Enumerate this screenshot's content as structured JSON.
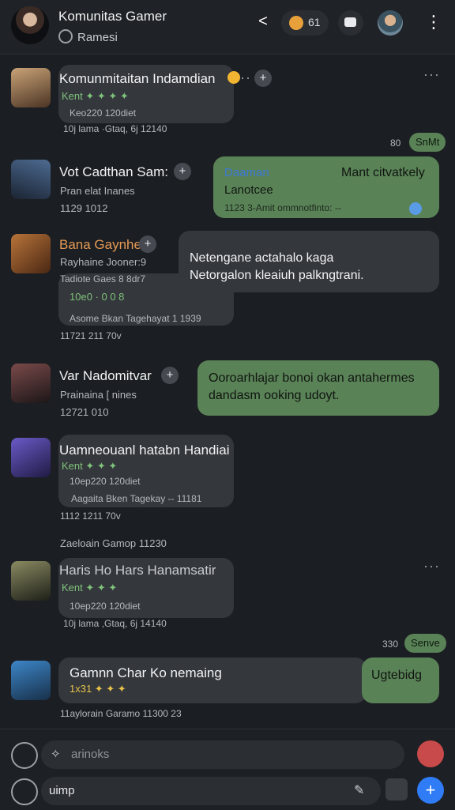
{
  "header": {
    "title": "Komunitas Gamer",
    "subtitle": "Ramesi",
    "pill_label": "61",
    "share_label": "<",
    "more_label": "⋮"
  },
  "messages": [
    {
      "name": "Komunmitaitan Indamdian",
      "green": "Kent ✦ ✦ ✦ ✦",
      "sub": "Keo220 120diet",
      "time": "10j lama ·Gtaq, 6j 12140"
    },
    {
      "name": "Vot Cadthan Sam:",
      "role": "Pran elat  Inanes",
      "time": "1129 1012"
    },
    {
      "name": "Bana Gaynhe",
      "role": "Rayhaine Jooner:9",
      "sub": "Tadiote Gaes 8 8dr7",
      "green": "10e0 · 0 0 8",
      "meta": "Asome Bkan Tagehayat 1 1939",
      "time": "11721 211 70v"
    },
    {
      "name": "Var Nadomitvar",
      "role": "Prainaina  [ nines",
      "time": "12721 010"
    },
    {
      "name": "Uamneouanl hatabn Handiai",
      "green": "Kent ✦ ✦ ✦",
      "sub": "10ep220 120diet",
      "meta": "Aagaita Bken Tagekay -- 11181",
      "time": "1112 1211 70v"
    },
    {
      "name": "Haris Ho Hars Hanamsatir",
      "green": "Kent ✦ ✦ ✦",
      "sub": "10ep220 120diet",
      "time": "10j lama ,Gtaq, 6j 14140"
    },
    {
      "name": "Gamnn Char Ko nemaing",
      "green": "1x31 ✦ ✦ ✦",
      "time": "11aylorain Garamo 11300 23"
    }
  ],
  "outgoing": [
    {
      "title": "Daaman",
      "text": "Mant citvatkely",
      "sub": "Lanotcee",
      "meta": "1123 3-Amit ommnotfinto: -- "
    },
    {
      "text1": "Netengane actahalo kaga",
      "text2": "Netorgalon kleaiuh palkngtrani."
    },
    {
      "text1": "Ooroarhlajar bonoi okan antahermes",
      "text2": "dandasm ooking udoyt."
    },
    {
      "text": "Ugtebidg"
    }
  ],
  "chips": {
    "c1": "SnMt",
    "c2": "Senve"
  },
  "time_labels": {
    "t1": "80",
    "t2": "330",
    "t3": "Zaeloain Gamop 11230"
  },
  "composer": {
    "placeholder": "arinoks",
    "input_value": "uimp"
  },
  "colors": {
    "accent_green": "#5a8257",
    "bubble_in": "#34373c",
    "background": "#1b1e22"
  }
}
